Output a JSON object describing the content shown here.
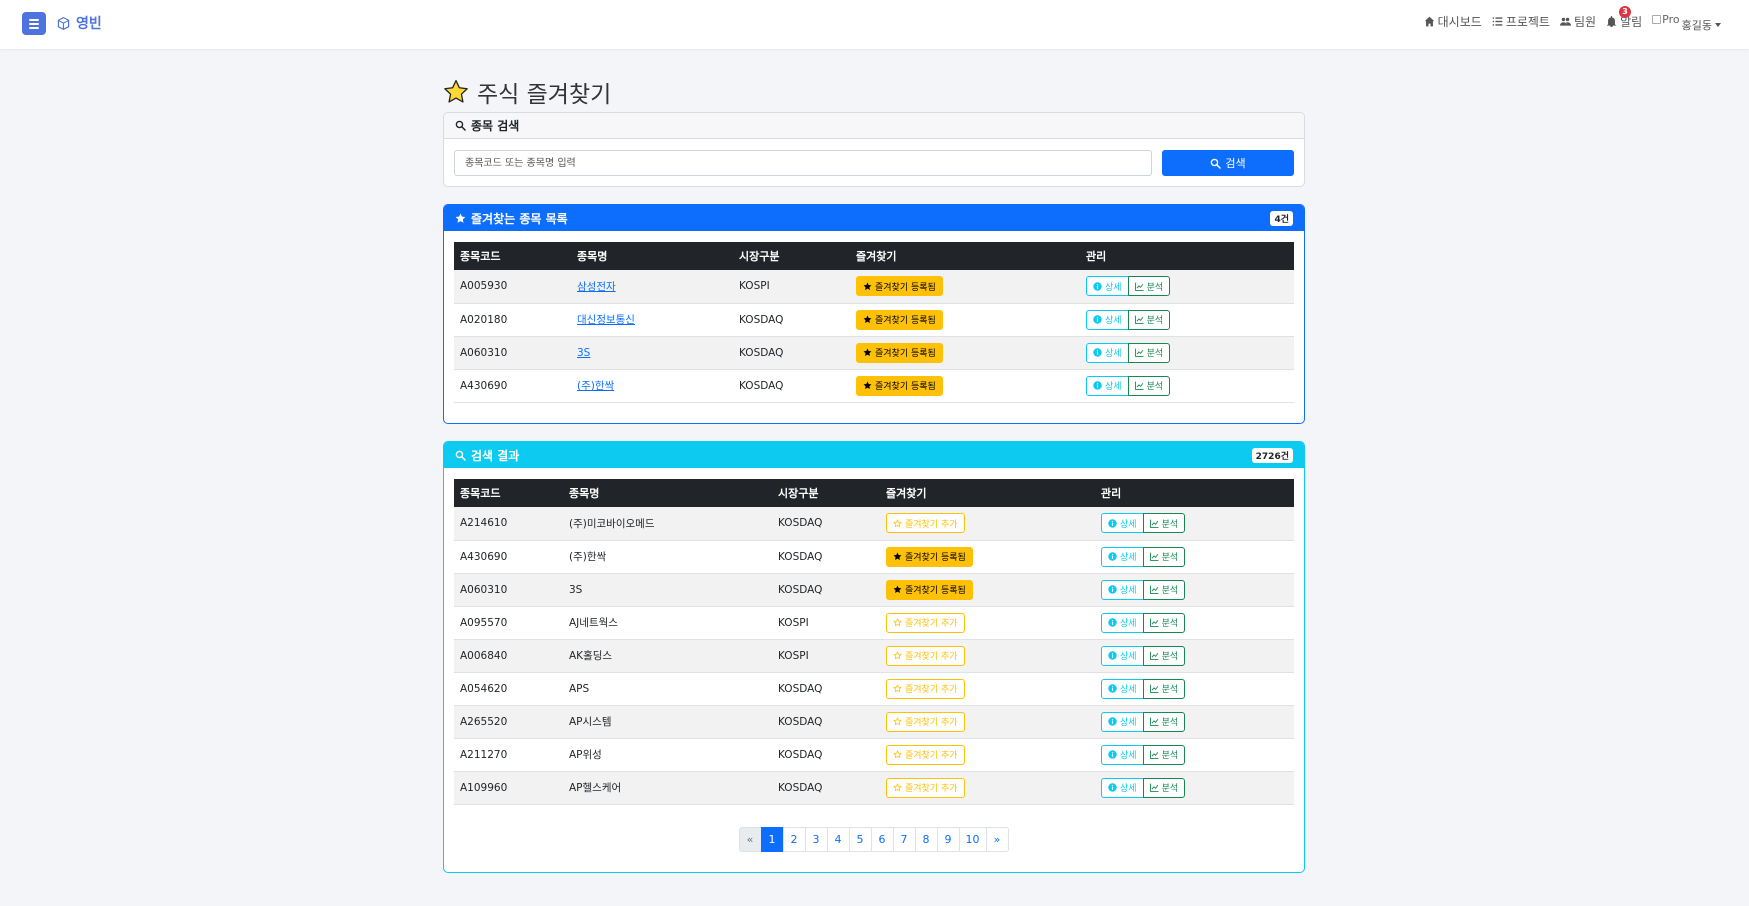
{
  "topbar": {
    "brand": "영빈",
    "nav": {
      "dashboard": "대시보드",
      "projects": "프로젝트",
      "team": "팀원",
      "alerts": "알림",
      "alerts_badge": "3",
      "profile_img_alt": "Pro",
      "username": "홍길동"
    }
  },
  "page": {
    "title": "주식 즐겨찾기"
  },
  "search": {
    "header": "종목 검색",
    "placeholder": "종목코드 또는 종목명 입력",
    "button": "검색"
  },
  "favorites": {
    "header": "즐겨찾는 종목 목록",
    "count": "4건",
    "columns": [
      "종목코드",
      "종목명",
      "시장구분",
      "즐겨찾기",
      "관리"
    ],
    "rows": [
      {
        "code": "A005930",
        "name": "삼성전자",
        "market": "KOSPI",
        "fav": "즐겨찾기 등록됨"
      },
      {
        "code": "A020180",
        "name": "대신정보통신",
        "market": "KOSDAQ",
        "fav": "즐겨찾기 등록됨"
      },
      {
        "code": "A060310",
        "name": "3S",
        "market": "KOSDAQ",
        "fav": "즐겨찾기 등록됨"
      },
      {
        "code": "A430690",
        "name": "(주)한싹",
        "market": "KOSDAQ",
        "fav": "즐겨찾기 등록됨"
      }
    ]
  },
  "results": {
    "header": "검색 결과",
    "count": "2726건",
    "columns": [
      "종목코드",
      "종목명",
      "시장구분",
      "즐겨찾기",
      "관리"
    ],
    "rows": [
      {
        "code": "A214610",
        "name": "(주)미코바이오메드",
        "market": "KOSDAQ",
        "fav": "즐겨찾기 추가",
        "fav_on": false
      },
      {
        "code": "A430690",
        "name": "(주)한싹",
        "market": "KOSDAQ",
        "fav": "즐겨찾기 등록됨",
        "fav_on": true
      },
      {
        "code": "A060310",
        "name": "3S",
        "market": "KOSDAQ",
        "fav": "즐겨찾기 등록됨",
        "fav_on": true
      },
      {
        "code": "A095570",
        "name": "AJ네트웍스",
        "market": "KOSPI",
        "fav": "즐겨찾기 추가",
        "fav_on": false
      },
      {
        "code": "A006840",
        "name": "AK홀딩스",
        "market": "KOSPI",
        "fav": "즐겨찾기 추가",
        "fav_on": false
      },
      {
        "code": "A054620",
        "name": "APS",
        "market": "KOSDAQ",
        "fav": "즐겨찾기 추가",
        "fav_on": false
      },
      {
        "code": "A265520",
        "name": "AP시스템",
        "market": "KOSDAQ",
        "fav": "즐겨찾기 추가",
        "fav_on": false
      },
      {
        "code": "A211270",
        "name": "AP위성",
        "market": "KOSDAQ",
        "fav": "즐겨찾기 추가",
        "fav_on": false
      },
      {
        "code": "A109960",
        "name": "AP헬스케어",
        "market": "KOSDAQ",
        "fav": "즐겨찾기 추가",
        "fav_on": false
      }
    ]
  },
  "actions": {
    "detail": "상세",
    "analysis": "분석"
  },
  "pagination": {
    "prev": "«",
    "pages": [
      "1",
      "2",
      "3",
      "4",
      "5",
      "6",
      "7",
      "8",
      "9",
      "10"
    ],
    "next": "»",
    "active": "1"
  },
  "colors": {
    "primary": "#0d6efd",
    "info": "#0dcaf0",
    "warning": "#ffc107",
    "success": "#198754",
    "brand": "#4e73df"
  }
}
